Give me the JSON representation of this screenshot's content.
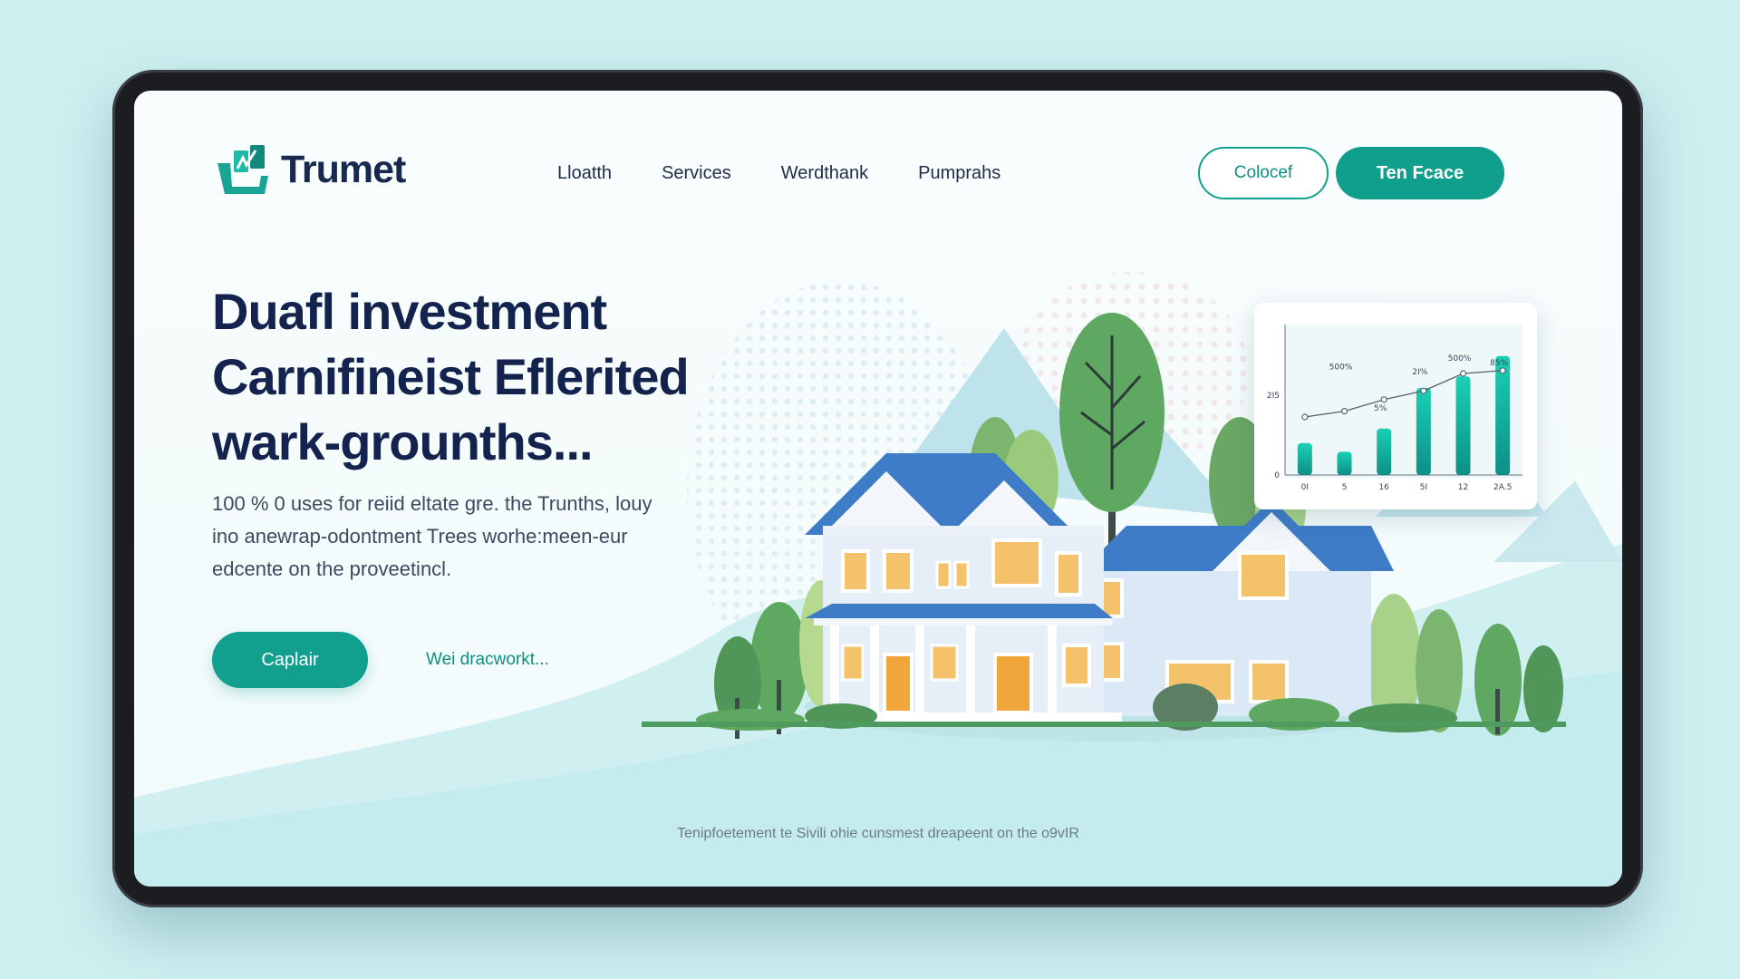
{
  "brand": {
    "name": "Trumet",
    "accent": "#109e8d",
    "navy": "#13234d"
  },
  "nav": {
    "items": [
      "Lloatth",
      "Services",
      "Werdthank",
      "Pumprahs"
    ]
  },
  "header_buttons": {
    "outline": "Colocef",
    "solid": "Ten Fcace"
  },
  "hero": {
    "title": "Duafl investment\nCarnifineist Eflerited\nwark-grounths...",
    "subtitle": "100 % 0 uses for reiid eltate gre. the Trunths, louy\nino anewrap-odontment Trees worhe:meen-eur\nedcente on the proveetincl.",
    "primary_cta": "Caplair",
    "secondary_link": "Wei dracworkt..."
  },
  "footer_note": "Tenipfoetement te Sivili ohie cunsmest dreapeent on the o9vIR",
  "icons": [
    "logo-mark-icon",
    "house-illustration",
    "tree-icon"
  ],
  "chart_data": {
    "type": "bar",
    "categories": [
      "0I",
      "5",
      "16",
      "5I",
      "12",
      "2A.5"
    ],
    "values": [
      22,
      16,
      32,
      60,
      68,
      82
    ],
    "line_series": [
      40,
      44,
      52,
      58,
      70,
      72
    ],
    "y_tick_labels": [
      "0",
      "2I5"
    ],
    "annotations": [
      "500%",
      "5%",
      "2I%",
      "500%",
      "85%"
    ],
    "ylim": [
      0,
      100
    ]
  }
}
